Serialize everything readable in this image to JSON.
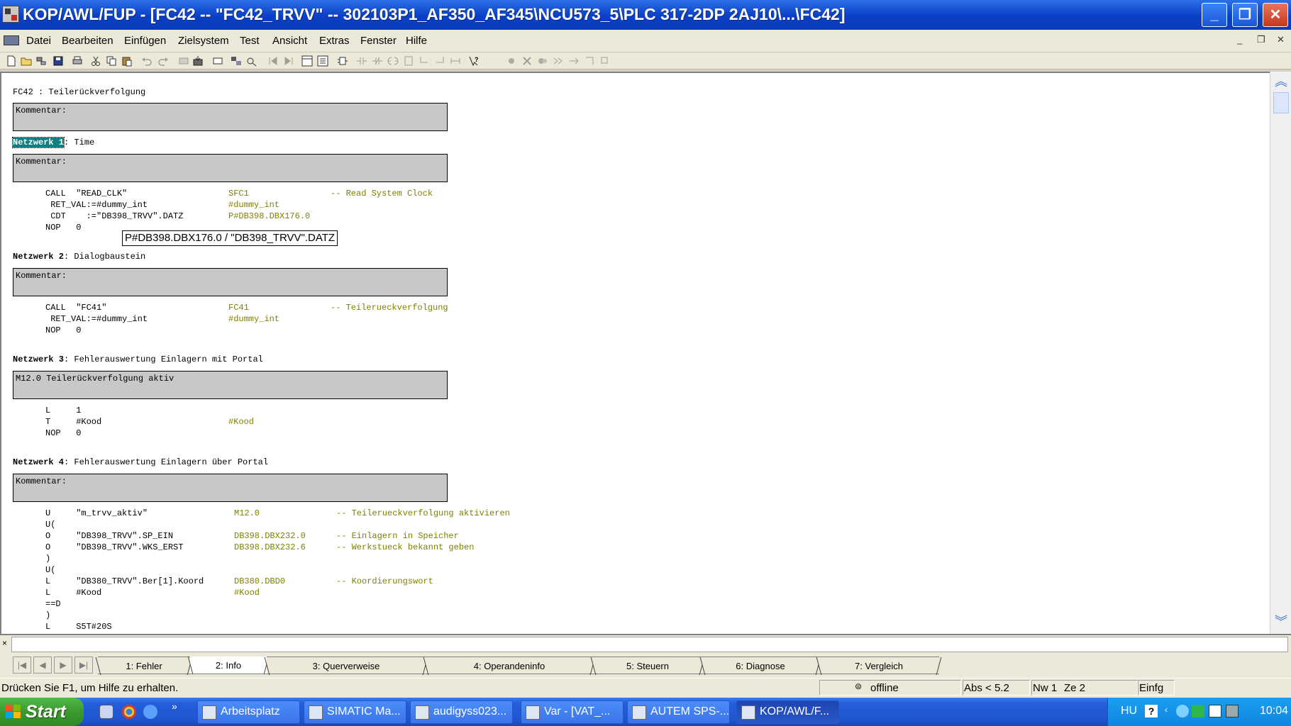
{
  "window": {
    "title": "KOP/AWL/FUP  - [FC42 -- \"FC42_TRVV\" -- 302103P1_AF350_AF345\\NCU573_5\\PLC 317-2DP 2AJ10\\...\\FC42]",
    "minimize": "_",
    "restore": "❐",
    "close": "✕"
  },
  "menu": {
    "items": [
      "Datei",
      "Bearbeiten",
      "Einfügen",
      "Zielsystem",
      "Test",
      "Ansicht",
      "Extras",
      "Fenster",
      "Hilfe"
    ],
    "mdi_min": "_",
    "mdi_restore": "❐",
    "mdi_close": "✕"
  },
  "editor": {
    "header": "FC42 : Teilerückverfolgung",
    "kommentar": "Kommentar:",
    "networks": [
      {
        "label": "Netzwerk 1",
        "title": ": Time",
        "comment": "Kommentar:",
        "lines": [
          [
            "CALL  \"READ_CLK\"",
            "SFC1",
            "-- Read System Clock"
          ],
          [
            " RET_VAL:=#dummy_int",
            "#dummy_int",
            ""
          ],
          [
            " CDT    :=\"DB398_TRVV\".DATZ",
            "P#DB398.DBX176.0",
            ""
          ],
          [
            "NOP   0",
            "",
            ""
          ]
        ]
      },
      {
        "label": "Netzwerk 2",
        "title": ": Dialogbaustein",
        "comment": "Kommentar:",
        "lines": [
          [
            "CALL  \"FC41\"",
            "FC41",
            "-- Teilerueckverfolgung"
          ],
          [
            " RET_VAL:=#dummy_int",
            "#dummy_int",
            ""
          ],
          [
            "NOP   0",
            "",
            ""
          ]
        ]
      },
      {
        "label": "Netzwerk 3",
        "title": ": Fehlerauswertung Einlagern mit Portal",
        "comment": "M12.0 Teilerückverfolgung aktiv",
        "lines": [
          [
            "L     1",
            "",
            ""
          ],
          [
            "T     #Kood",
            "#Kood",
            ""
          ],
          [
            "NOP   0",
            "",
            ""
          ]
        ]
      },
      {
        "label": "Netzwerk 4",
        "title": ": Fehlerauswertung Einlagern über Portal",
        "comment": "Kommentar:",
        "lines": [
          [
            "U     \"m_trvv_aktiv\"",
            "M12.0",
            "-- Teilerueckverfolgung aktivieren"
          ],
          [
            "U(",
            "",
            ""
          ],
          [
            "O     \"DB398_TRVV\".SP_EIN",
            "DB398.DBX232.0",
            "-- Einlagern in Speicher"
          ],
          [
            "O     \"DB398_TRVV\".WKS_ERST",
            "DB398.DBX232.6",
            "-- Werkstueck bekannt geben"
          ],
          [
            ")",
            "",
            ""
          ],
          [
            "U(",
            "",
            ""
          ],
          [
            "L     \"DB380_TRVV\".Ber[1].Koord",
            "DB380.DBD0",
            "-- Koordierungswort"
          ],
          [
            "L     #Kood",
            "#Kood",
            ""
          ],
          [
            "==D",
            "",
            ""
          ],
          [
            ")",
            "",
            ""
          ],
          [
            "L     S5T#20S",
            "",
            ""
          ]
        ]
      }
    ],
    "tooltip": "P#DB398.DBX176.0 / \"DB398_TRVV\".DATZ"
  },
  "details": {
    "close": "×",
    "nav": [
      "|◀",
      "◀",
      "▶",
      "▶|"
    ],
    "tabs": [
      "1: Fehler",
      "2: Info",
      "3: Querverweise",
      "4: Operandeninfo",
      "5: Steuern",
      "6: Diagnose",
      "7: Vergleich"
    ],
    "active_tab": "2: Info"
  },
  "status": {
    "help": "Drücken Sie F1, um Hilfe zu erhalten.",
    "mode": "offline",
    "abs": "Abs < 5.2",
    "nw": "Nw 1",
    "ze": "Ze 2",
    "insert": "Einfg"
  },
  "taskbar": {
    "start": "Start",
    "tasks": [
      "Arbeitsplatz",
      "SIMATIC Ma...",
      "audigyss023...",
      "Var - [VAT_...",
      "AUTEM SPS-...",
      "KOP/AWL/F..."
    ],
    "active_task": "KOP/AWL/F...",
    "language": "HU",
    "clock": "10:04"
  },
  "colors": {
    "title_bar": "#0a3fc6",
    "comment_box": "#c8c8c8",
    "code_comment": "#808000",
    "highlight": "#0f7f7f",
    "taskbar": "#245edb",
    "start": "#3a9a2f"
  }
}
